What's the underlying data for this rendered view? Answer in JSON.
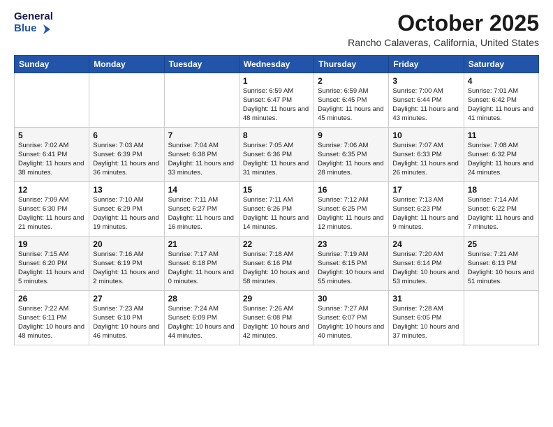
{
  "logo": {
    "line1": "General",
    "line2": "Blue"
  },
  "title": "October 2025",
  "location": "Rancho Calaveras, California, United States",
  "weekdays": [
    "Sunday",
    "Monday",
    "Tuesday",
    "Wednesday",
    "Thursday",
    "Friday",
    "Saturday"
  ],
  "weeks": [
    [
      {
        "day": "",
        "info": ""
      },
      {
        "day": "",
        "info": ""
      },
      {
        "day": "",
        "info": ""
      },
      {
        "day": "1",
        "info": "Sunrise: 6:59 AM\nSunset: 6:47 PM\nDaylight: 11 hours\nand 48 minutes."
      },
      {
        "day": "2",
        "info": "Sunrise: 6:59 AM\nSunset: 6:45 PM\nDaylight: 11 hours\nand 45 minutes."
      },
      {
        "day": "3",
        "info": "Sunrise: 7:00 AM\nSunset: 6:44 PM\nDaylight: 11 hours\nand 43 minutes."
      },
      {
        "day": "4",
        "info": "Sunrise: 7:01 AM\nSunset: 6:42 PM\nDaylight: 11 hours\nand 41 minutes."
      }
    ],
    [
      {
        "day": "5",
        "info": "Sunrise: 7:02 AM\nSunset: 6:41 PM\nDaylight: 11 hours\nand 38 minutes."
      },
      {
        "day": "6",
        "info": "Sunrise: 7:03 AM\nSunset: 6:39 PM\nDaylight: 11 hours\nand 36 minutes."
      },
      {
        "day": "7",
        "info": "Sunrise: 7:04 AM\nSunset: 6:38 PM\nDaylight: 11 hours\nand 33 minutes."
      },
      {
        "day": "8",
        "info": "Sunrise: 7:05 AM\nSunset: 6:36 PM\nDaylight: 11 hours\nand 31 minutes."
      },
      {
        "day": "9",
        "info": "Sunrise: 7:06 AM\nSunset: 6:35 PM\nDaylight: 11 hours\nand 28 minutes."
      },
      {
        "day": "10",
        "info": "Sunrise: 7:07 AM\nSunset: 6:33 PM\nDaylight: 11 hours\nand 26 minutes."
      },
      {
        "day": "11",
        "info": "Sunrise: 7:08 AM\nSunset: 6:32 PM\nDaylight: 11 hours\nand 24 minutes."
      }
    ],
    [
      {
        "day": "12",
        "info": "Sunrise: 7:09 AM\nSunset: 6:30 PM\nDaylight: 11 hours\nand 21 minutes."
      },
      {
        "day": "13",
        "info": "Sunrise: 7:10 AM\nSunset: 6:29 PM\nDaylight: 11 hours\nand 19 minutes."
      },
      {
        "day": "14",
        "info": "Sunrise: 7:11 AM\nSunset: 6:27 PM\nDaylight: 11 hours\nand 16 minutes."
      },
      {
        "day": "15",
        "info": "Sunrise: 7:11 AM\nSunset: 6:26 PM\nDaylight: 11 hours\nand 14 minutes."
      },
      {
        "day": "16",
        "info": "Sunrise: 7:12 AM\nSunset: 6:25 PM\nDaylight: 11 hours\nand 12 minutes."
      },
      {
        "day": "17",
        "info": "Sunrise: 7:13 AM\nSunset: 6:23 PM\nDaylight: 11 hours\nand 9 minutes."
      },
      {
        "day": "18",
        "info": "Sunrise: 7:14 AM\nSunset: 6:22 PM\nDaylight: 11 hours\nand 7 minutes."
      }
    ],
    [
      {
        "day": "19",
        "info": "Sunrise: 7:15 AM\nSunset: 6:20 PM\nDaylight: 11 hours\nand 5 minutes."
      },
      {
        "day": "20",
        "info": "Sunrise: 7:16 AM\nSunset: 6:19 PM\nDaylight: 11 hours\nand 2 minutes."
      },
      {
        "day": "21",
        "info": "Sunrise: 7:17 AM\nSunset: 6:18 PM\nDaylight: 11 hours\nand 0 minutes."
      },
      {
        "day": "22",
        "info": "Sunrise: 7:18 AM\nSunset: 6:16 PM\nDaylight: 10 hours\nand 58 minutes."
      },
      {
        "day": "23",
        "info": "Sunrise: 7:19 AM\nSunset: 6:15 PM\nDaylight: 10 hours\nand 55 minutes."
      },
      {
        "day": "24",
        "info": "Sunrise: 7:20 AM\nSunset: 6:14 PM\nDaylight: 10 hours\nand 53 minutes."
      },
      {
        "day": "25",
        "info": "Sunrise: 7:21 AM\nSunset: 6:13 PM\nDaylight: 10 hours\nand 51 minutes."
      }
    ],
    [
      {
        "day": "26",
        "info": "Sunrise: 7:22 AM\nSunset: 6:11 PM\nDaylight: 10 hours\nand 48 minutes."
      },
      {
        "day": "27",
        "info": "Sunrise: 7:23 AM\nSunset: 6:10 PM\nDaylight: 10 hours\nand 46 minutes."
      },
      {
        "day": "28",
        "info": "Sunrise: 7:24 AM\nSunset: 6:09 PM\nDaylight: 10 hours\nand 44 minutes."
      },
      {
        "day": "29",
        "info": "Sunrise: 7:26 AM\nSunset: 6:08 PM\nDaylight: 10 hours\nand 42 minutes."
      },
      {
        "day": "30",
        "info": "Sunrise: 7:27 AM\nSunset: 6:07 PM\nDaylight: 10 hours\nand 40 minutes."
      },
      {
        "day": "31",
        "info": "Sunrise: 7:28 AM\nSunset: 6:05 PM\nDaylight: 10 hours\nand 37 minutes."
      },
      {
        "day": "",
        "info": ""
      }
    ]
  ]
}
